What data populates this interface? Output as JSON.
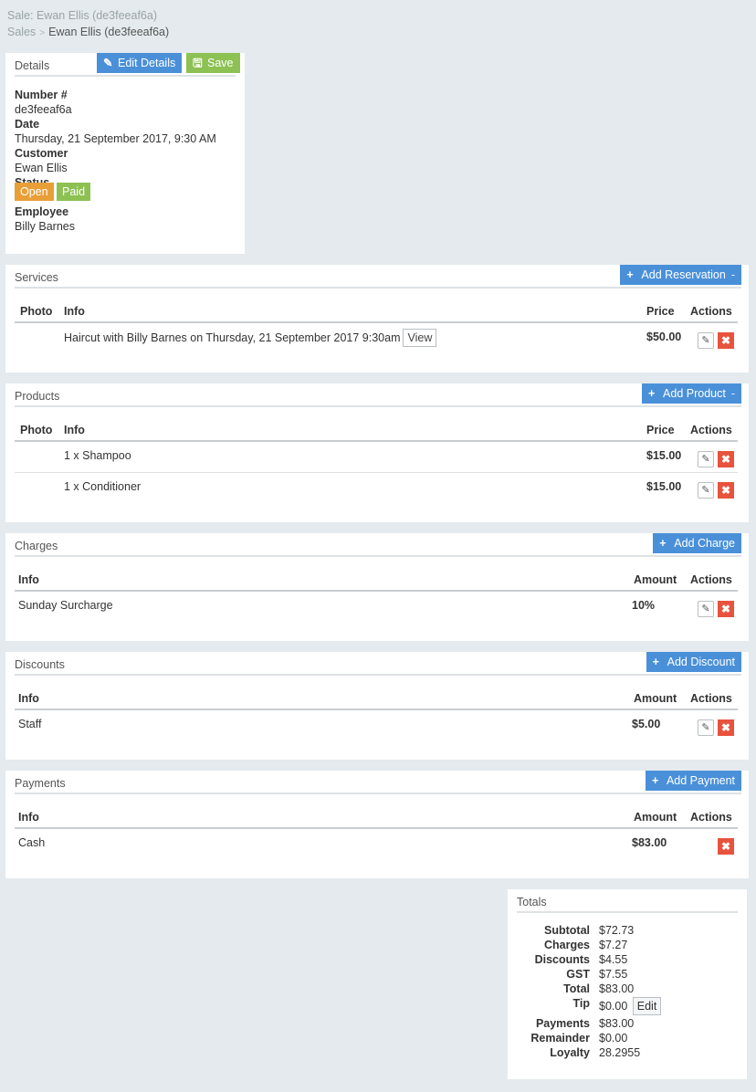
{
  "page_title": "Sale: Ewan Ellis (de3feeaf6a)",
  "breadcrumb": {
    "root": "Sales",
    "sep": ">",
    "current": "Ewan Ellis (de3feeaf6a)"
  },
  "details": {
    "title": "Details",
    "edit_label": "Edit Details",
    "save_label": "Save",
    "number_label": "Number #",
    "number": "de3feeaf6a",
    "date_label": "Date",
    "date": "Thursday, 21 September 2017, 9:30 AM",
    "customer_label": "Customer",
    "customer": "Ewan Ellis",
    "status_label": "Status",
    "status_open": "Open",
    "status_paid": "Paid",
    "employee_label": "Employee",
    "employee": "Billy Barnes"
  },
  "services": {
    "title": "Services",
    "add_label": "Add Reservation",
    "caret": "-",
    "headers": {
      "photo": "Photo",
      "info": "Info",
      "price": "Price",
      "actions": "Actions"
    },
    "rows": [
      {
        "info": "Haircut with Billy Barnes on Thursday, 21 September 2017 9:30am",
        "view": "View",
        "price": "$50.00"
      }
    ]
  },
  "products": {
    "title": "Products",
    "add_label": "Add Product",
    "caret": "-",
    "headers": {
      "photo": "Photo",
      "info": "Info",
      "price": "Price",
      "actions": "Actions"
    },
    "rows": [
      {
        "info": "1 x Shampoo",
        "price": "$15.00"
      },
      {
        "info": "1 x Conditioner",
        "price": "$15.00"
      }
    ]
  },
  "charges": {
    "title": "Charges",
    "add_label": "Add Charge",
    "headers": {
      "info": "Info",
      "amount": "Amount",
      "actions": "Actions"
    },
    "rows": [
      {
        "info": "Sunday Surcharge",
        "amount": "10%"
      }
    ]
  },
  "discounts": {
    "title": "Discounts",
    "add_label": "Add Discount",
    "headers": {
      "info": "Info",
      "amount": "Amount",
      "actions": "Actions"
    },
    "rows": [
      {
        "info": "Staff",
        "amount": "$5.00"
      }
    ]
  },
  "payments": {
    "title": "Payments",
    "add_label": "Add Payment",
    "headers": {
      "info": "Info",
      "amount": "Amount",
      "actions": "Actions"
    },
    "rows": [
      {
        "info": "Cash",
        "amount": "$83.00"
      }
    ]
  },
  "totals": {
    "title": "Totals",
    "subtotal_label": "Subtotal",
    "subtotal": "$72.73",
    "charges_label": "Charges",
    "charges": "$7.27",
    "discounts_label": "Discounts",
    "discounts": "$4.55",
    "gst_label": "GST",
    "gst": "$7.55",
    "total_label": "Total",
    "total": "$83.00",
    "tip_label": "Tip",
    "tip": "$0.00",
    "tip_edit": "Edit",
    "payments_label": "Payments",
    "payments": "$83.00",
    "remainder_label": "Remainder",
    "remainder": "$0.00",
    "loyalty_label": "Loyalty",
    "loyalty": "28.2955"
  },
  "icons": {
    "edit": "edit-icon",
    "save": "save-icon",
    "plus": "plus-icon",
    "pencil": "pencil-icon",
    "delete": "close-icon"
  },
  "colors": {
    "primary": "#4a90d9",
    "success": "#8dc153",
    "warning": "#e89f38",
    "danger": "#e8533d",
    "background": "#e4eaee"
  }
}
